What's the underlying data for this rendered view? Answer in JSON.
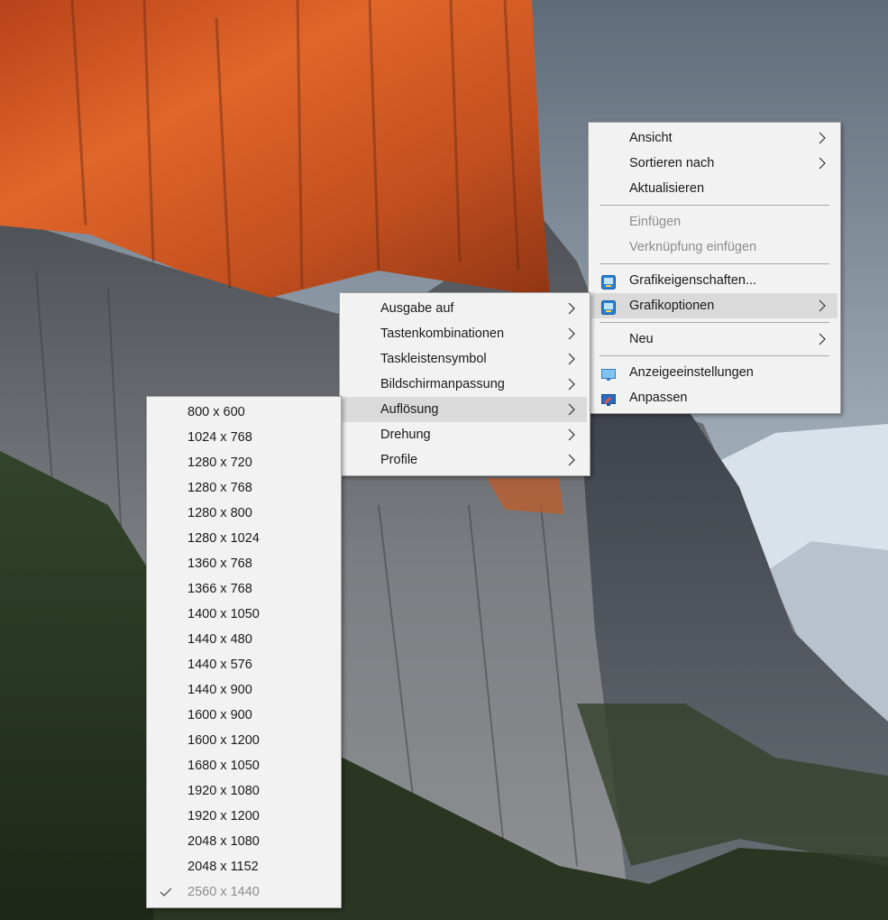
{
  "wallpaper": {
    "sky_color": "#b8c4ce",
    "rock_lit_color": "#d0531e",
    "rock_shadow_color": "#6e7175",
    "forest_color": "#2c3a24"
  },
  "context_menu": {
    "items": [
      {
        "label": "Ansicht",
        "submenu": true
      },
      {
        "label": "Sortieren nach",
        "submenu": true
      },
      {
        "label": "Aktualisieren"
      },
      {
        "label": "Einfügen",
        "disabled": true
      },
      {
        "label": "Verknüpfung einfügen",
        "disabled": true
      },
      {
        "label": "Grafikeigenschaften...",
        "icon": "intel-graphics-icon"
      },
      {
        "label": "Grafikoptionen",
        "icon": "intel-graphics-icon",
        "submenu": true,
        "highlighted": true
      },
      {
        "label": "Neu",
        "submenu": true
      },
      {
        "label": "Anzeigeeinstellungen",
        "icon": "display-settings-icon"
      },
      {
        "label": "Anpassen",
        "icon": "personalize-icon"
      }
    ]
  },
  "graphics_menu": {
    "items": [
      {
        "label": "Ausgabe auf",
        "submenu": true
      },
      {
        "label": "Tastenkombinationen",
        "submenu": true
      },
      {
        "label": "Taskleistensymbol",
        "submenu": true
      },
      {
        "label": "Bildschirmanpassung",
        "submenu": true
      },
      {
        "label": "Auflösung",
        "submenu": true,
        "highlighted": true
      },
      {
        "label": "Drehung",
        "submenu": true
      },
      {
        "label": "Profile",
        "submenu": true
      }
    ]
  },
  "resolution_menu": {
    "items": [
      {
        "label": "800 x 600"
      },
      {
        "label": "1024 x 768"
      },
      {
        "label": "1280 x 720"
      },
      {
        "label": "1280 x 768"
      },
      {
        "label": "1280 x 800"
      },
      {
        "label": "1280 x 1024"
      },
      {
        "label": "1360 x 768"
      },
      {
        "label": "1366 x 768"
      },
      {
        "label": "1400 x 1050"
      },
      {
        "label": "1440 x 480"
      },
      {
        "label": "1440 x 576"
      },
      {
        "label": "1440 x 900"
      },
      {
        "label": "1600 x 900"
      },
      {
        "label": "1600 x 1200"
      },
      {
        "label": "1680 x 1050"
      },
      {
        "label": "1920 x 1080"
      },
      {
        "label": "1920 x 1200"
      },
      {
        "label": "2048 x 1080"
      },
      {
        "label": "2048 x 1152"
      },
      {
        "label": "2560 x 1440",
        "checked": true,
        "disabled": true
      }
    ]
  }
}
